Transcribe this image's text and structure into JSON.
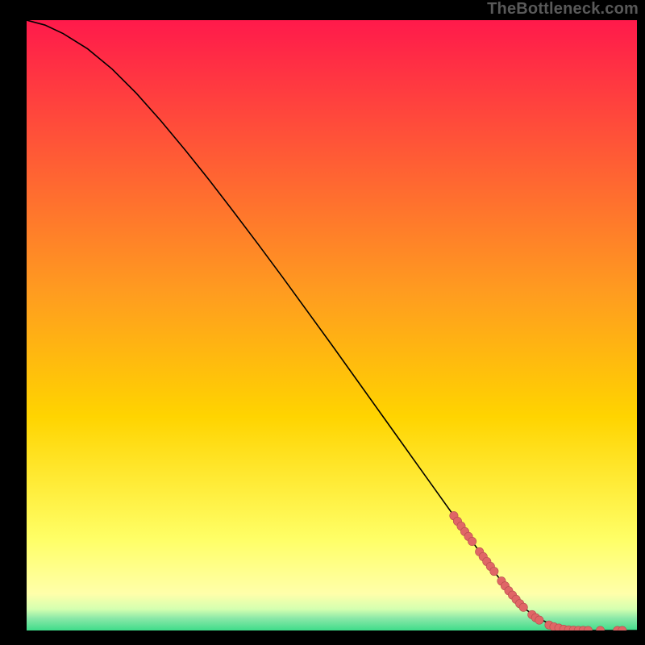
{
  "watermark": "TheBottleneck.com",
  "colors": {
    "top": "#ff1a4b",
    "mid": "#ffd400",
    "green": "#3fdc8a",
    "curve": "#000000",
    "marker": "#e06666",
    "marker_stroke": "#b64d4d"
  },
  "chart_data": {
    "type": "line",
    "title": "",
    "xlabel": "",
    "ylabel": "",
    "xlim": [
      0,
      100
    ],
    "ylim": [
      0,
      100
    ],
    "curve": {
      "x": [
        0,
        3,
        6,
        10,
        14,
        18,
        22,
        26,
        30,
        34,
        38,
        42,
        46,
        50,
        54,
        58,
        62,
        66,
        70,
        74,
        78,
        82,
        84,
        86,
        88,
        90,
        92,
        94,
        96,
        98,
        100
      ],
      "y": [
        100,
        99.2,
        97.8,
        95.3,
        92.0,
        88.0,
        83.5,
        78.7,
        73.7,
        68.5,
        63.2,
        57.8,
        52.3,
        46.8,
        41.2,
        35.6,
        30.0,
        24.4,
        18.8,
        13.2,
        7.8,
        3.3,
        1.9,
        1.0,
        0.4,
        0.1,
        0,
        0,
        0,
        0,
        0
      ]
    },
    "markers": [
      {
        "x": 70.0,
        "y": 18.8
      },
      {
        "x": 70.6,
        "y": 17.9
      },
      {
        "x": 71.2,
        "y": 17.1
      },
      {
        "x": 71.8,
        "y": 16.2
      },
      {
        "x": 72.4,
        "y": 15.4
      },
      {
        "x": 73.0,
        "y": 14.6
      },
      {
        "x": 74.2,
        "y": 12.9
      },
      {
        "x": 74.8,
        "y": 12.1
      },
      {
        "x": 75.4,
        "y": 11.3
      },
      {
        "x": 76.0,
        "y": 10.5
      },
      {
        "x": 76.6,
        "y": 9.7
      },
      {
        "x": 77.8,
        "y": 8.1
      },
      {
        "x": 78.4,
        "y": 7.3
      },
      {
        "x": 79.0,
        "y": 6.5
      },
      {
        "x": 79.6,
        "y": 5.8
      },
      {
        "x": 80.2,
        "y": 5.1
      },
      {
        "x": 80.8,
        "y": 4.4
      },
      {
        "x": 81.4,
        "y": 3.8
      },
      {
        "x": 82.8,
        "y": 2.6
      },
      {
        "x": 83.4,
        "y": 2.1
      },
      {
        "x": 84.0,
        "y": 1.7
      },
      {
        "x": 85.6,
        "y": 0.9
      },
      {
        "x": 86.4,
        "y": 0.6
      },
      {
        "x": 87.2,
        "y": 0.4
      },
      {
        "x": 88.0,
        "y": 0.2
      },
      {
        "x": 88.8,
        "y": 0.1
      },
      {
        "x": 89.6,
        "y": 0.05
      },
      {
        "x": 90.4,
        "y": 0.02
      },
      {
        "x": 91.2,
        "y": 0.01
      },
      {
        "x": 92.0,
        "y": 0
      },
      {
        "x": 94.0,
        "y": 0
      },
      {
        "x": 96.8,
        "y": 0
      },
      {
        "x": 97.6,
        "y": 0
      }
    ]
  }
}
